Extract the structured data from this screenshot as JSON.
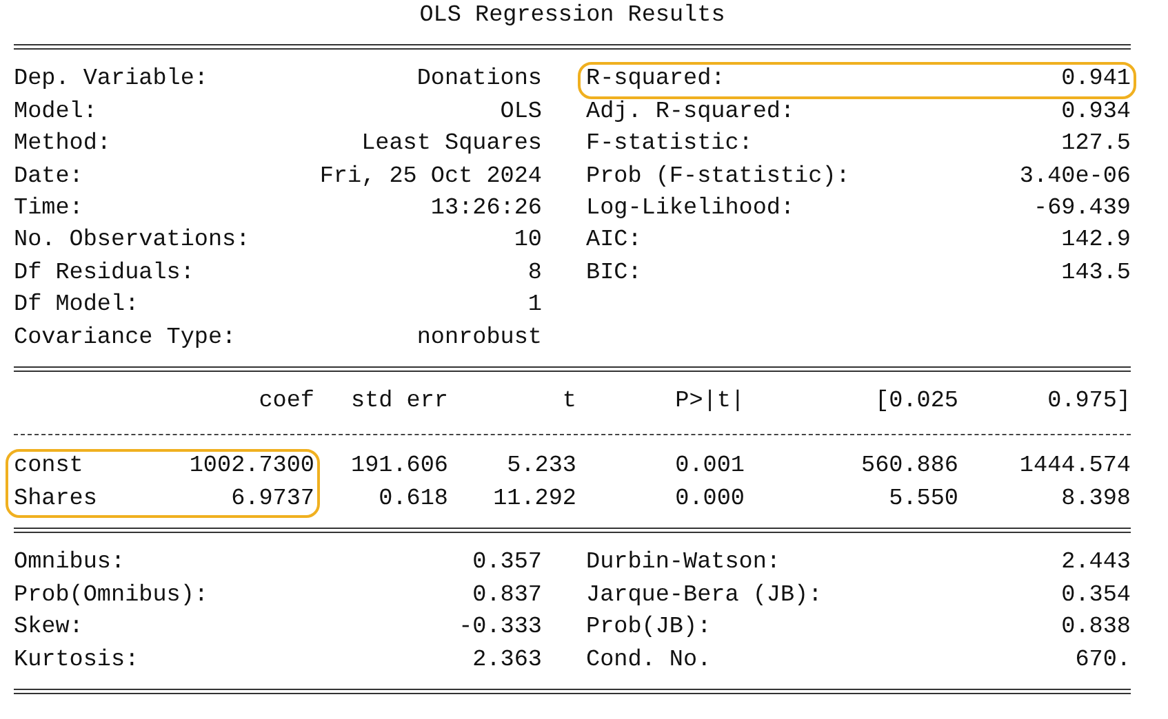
{
  "title": "OLS Regression Results",
  "model_info": [
    {
      "label": "Dep. Variable:",
      "value": "Donations"
    },
    {
      "label": "Model:",
      "value": "OLS"
    },
    {
      "label": "Method:",
      "value": "Least Squares"
    },
    {
      "label": "Date:",
      "value": "Fri, 25 Oct 2024"
    },
    {
      "label": "Time:",
      "value": "13:26:26"
    },
    {
      "label": "No. Observations:",
      "value": "10"
    },
    {
      "label": "Df Residuals:",
      "value": "8"
    },
    {
      "label": "Df Model:",
      "value": "1"
    },
    {
      "label": "Covariance Type:",
      "value": "nonrobust"
    }
  ],
  "fit_stats": [
    {
      "label": "R-squared:",
      "value": "0.941",
      "highlighted": true
    },
    {
      "label": "Adj. R-squared:",
      "value": "0.934",
      "highlighted": false
    },
    {
      "label": "F-statistic:",
      "value": "127.5",
      "highlighted": false
    },
    {
      "label": "Prob (F-statistic):",
      "value": "3.40e-06",
      "highlighted": false
    },
    {
      "label": "Log-Likelihood:",
      "value": "-69.439",
      "highlighted": false
    },
    {
      "label": "AIC:",
      "value": "142.9",
      "highlighted": false
    },
    {
      "label": "BIC:",
      "value": "143.5",
      "highlighted": false
    }
  ],
  "coefficients": {
    "columns": [
      "coef",
      "std err",
      "t",
      "P>|t|",
      "[0.025",
      "0.975]"
    ],
    "rows": [
      {
        "name": "const",
        "values": [
          "1002.7300",
          "191.606",
          "5.233",
          "0.001",
          "560.886",
          "1444.574"
        ],
        "highlighted": true
      },
      {
        "name": "Shares",
        "values": [
          "6.9737",
          "0.618",
          "11.292",
          "0.000",
          "5.550",
          "8.398"
        ],
        "highlighted": true
      }
    ]
  },
  "diagnostics_left": [
    {
      "label": "Omnibus:",
      "value": "0.357"
    },
    {
      "label": "Prob(Omnibus):",
      "value": "0.837"
    },
    {
      "label": "Skew:",
      "value": "-0.333"
    },
    {
      "label": "Kurtosis:",
      "value": "2.363"
    }
  ],
  "diagnostics_right": [
    {
      "label": "Durbin-Watson:",
      "value": "2.443"
    },
    {
      "label": "Jarque-Bera (JB):",
      "value": "0.354"
    },
    {
      "label": "Prob(JB):",
      "value": "0.838"
    },
    {
      "label": "Cond. No.",
      "value": "670."
    }
  ]
}
